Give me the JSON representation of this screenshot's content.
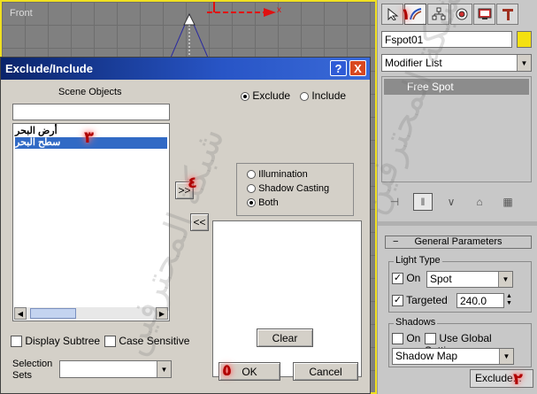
{
  "viewport": {
    "label": "Front",
    "axis_x": "x"
  },
  "command_panel": {
    "object_name": "Fspot01",
    "color": "#f4e010",
    "modifier_list": "Modifier List",
    "stack_item": "Free Spot",
    "tabs": [
      "create-icon",
      "modify-icon",
      "hierarchy-icon",
      "motion-icon",
      "display-icon",
      "utilities-icon"
    ],
    "rollout_title": "General Parameters",
    "light_type_label": "Light Type",
    "on_label": "On",
    "light_type_value": "Spot",
    "targeted_label": "Targeted",
    "targeted_value": "240.0",
    "shadows_label": "Shadows",
    "shadows_on_label": "On",
    "global_settings_label": "Use Global Settings",
    "shadow_type": "Shadow Map",
    "exclude_button": "Exclude..."
  },
  "dialog": {
    "title": "Exclude/Include",
    "help_btn": "?",
    "close_btn": "X",
    "scene_objects_label": "Scene Objects",
    "objects": [
      "أرض البحر",
      "سطح البحر"
    ],
    "move_right": ">>",
    "move_left": "<<",
    "exclude_label": "Exclude",
    "include_label": "Include",
    "illumination_label": "Illumination",
    "shadow_casting_label": "Shadow Casting",
    "both_label": "Both",
    "clear_button": "Clear",
    "display_subtree": "Display Subtree",
    "case_sensitive": "Case Sensitive",
    "selection_sets_label1": "Selection",
    "selection_sets_label2": "Sets",
    "ok_button": "OK",
    "cancel_button": "Cancel"
  },
  "badges": {
    "b1": "١",
    "b2": "٢",
    "b3": "٣",
    "b4": "٤",
    "b5": "٥"
  }
}
